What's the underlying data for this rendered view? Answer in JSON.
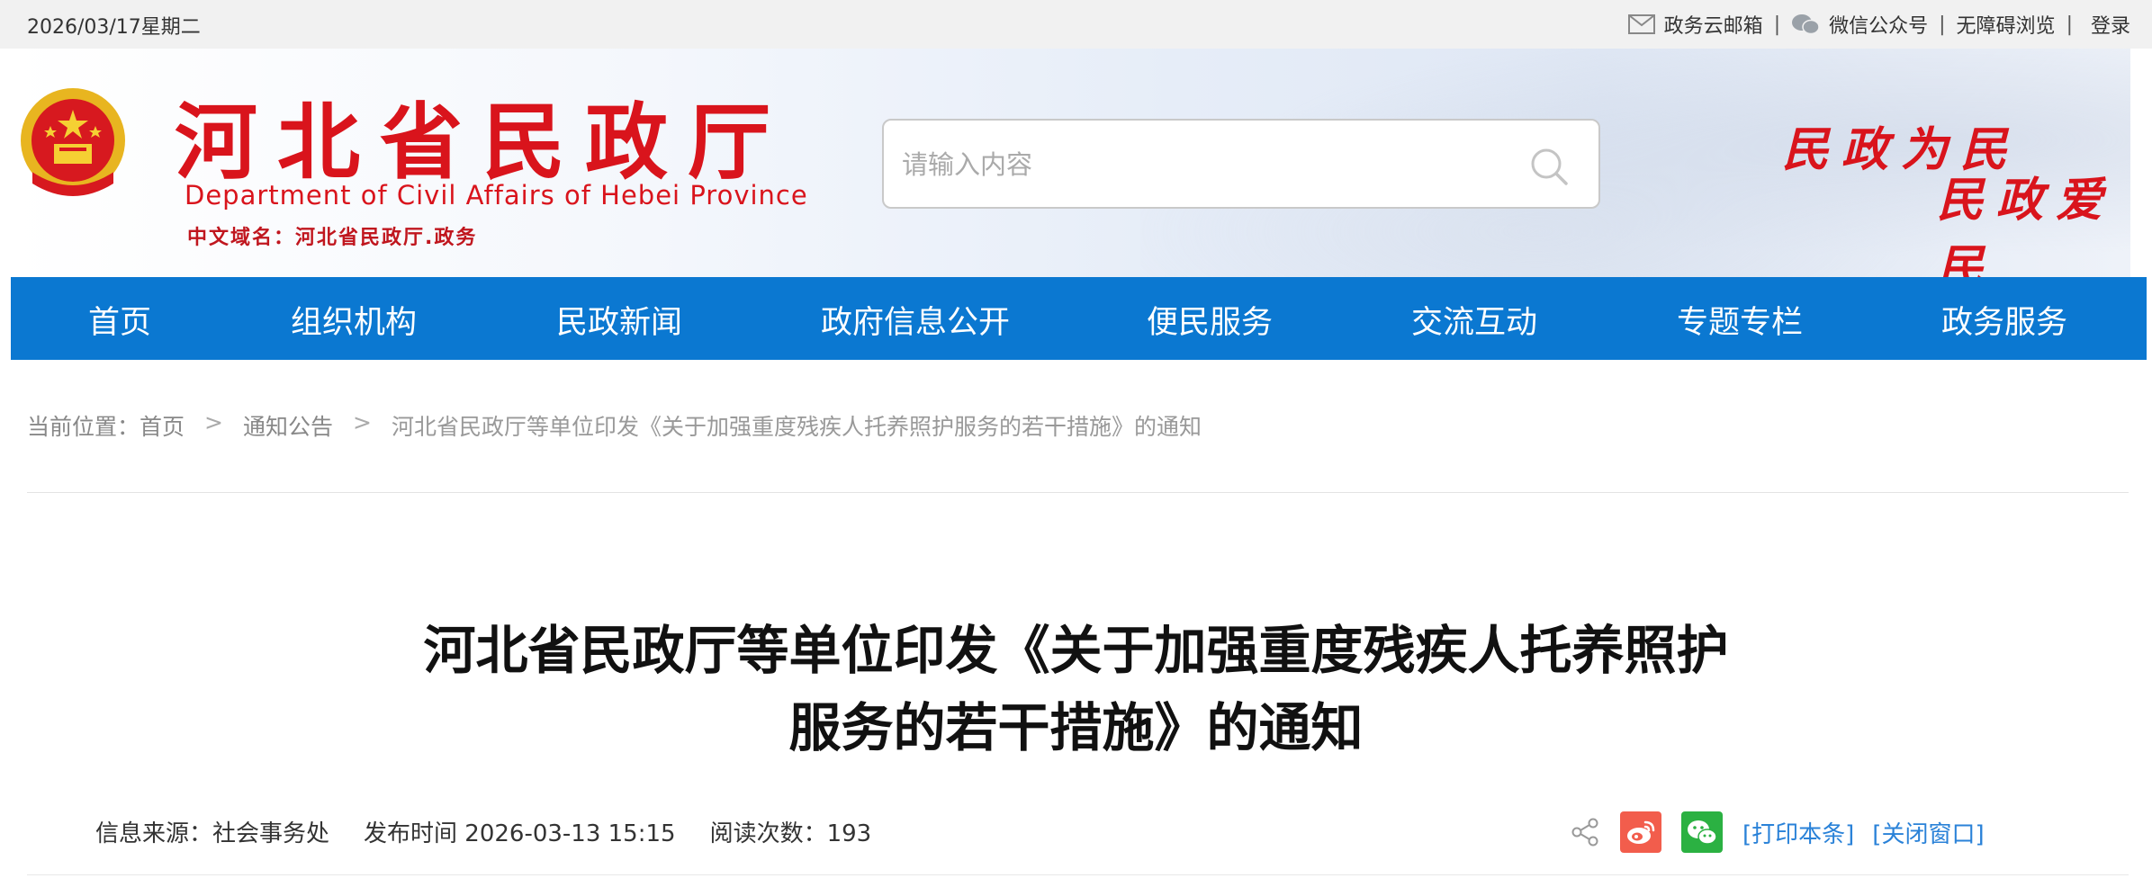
{
  "topbar": {
    "date": "2026/03/17星期二",
    "links": {
      "email": "政务云邮箱",
      "wechat": "微信公众号",
      "accessibility": "无障碍浏览",
      "login": "登录"
    },
    "separator": "|"
  },
  "header": {
    "site_name": "河北省民政厅",
    "site_name_en": "Department of Civil Affairs of Hebei Province",
    "domain": "中文域名：河北省民政厅.政务",
    "search_placeholder": "请输入内容",
    "slogan_line1": "民政为民",
    "slogan_line2": "民政爱民"
  },
  "nav": {
    "items": [
      "首页",
      "组织机构",
      "民政新闻",
      "政府信息公开",
      "便民服务",
      "交流互动",
      "专题专栏",
      "政务服务"
    ]
  },
  "breadcrumb": {
    "prefix": "当前位置：",
    "home": "首页",
    "section": "通知公告",
    "current": "河北省民政厅等单位印发《关于加强重度残疾人托养照护服务的若干措施》的通知",
    "arrow": ">"
  },
  "article": {
    "title_line1": "河北省民政厅等单位印发《关于加强重度残疾人托养照护",
    "title_line2": "服务的若干措施》的通知",
    "source": "信息来源：社会事务处",
    "published": "发布时间 2026-03-13 15:15",
    "reads": "阅读次数：193",
    "print_label": "[打印本条]",
    "close_label": "[关闭窗口]"
  },
  "colors": {
    "brand_red": "#d9141c",
    "nav_blue": "#0b78d1",
    "link_blue": "#2a82d8",
    "weibo": "#f25d4c",
    "wechat": "#2bb142"
  }
}
